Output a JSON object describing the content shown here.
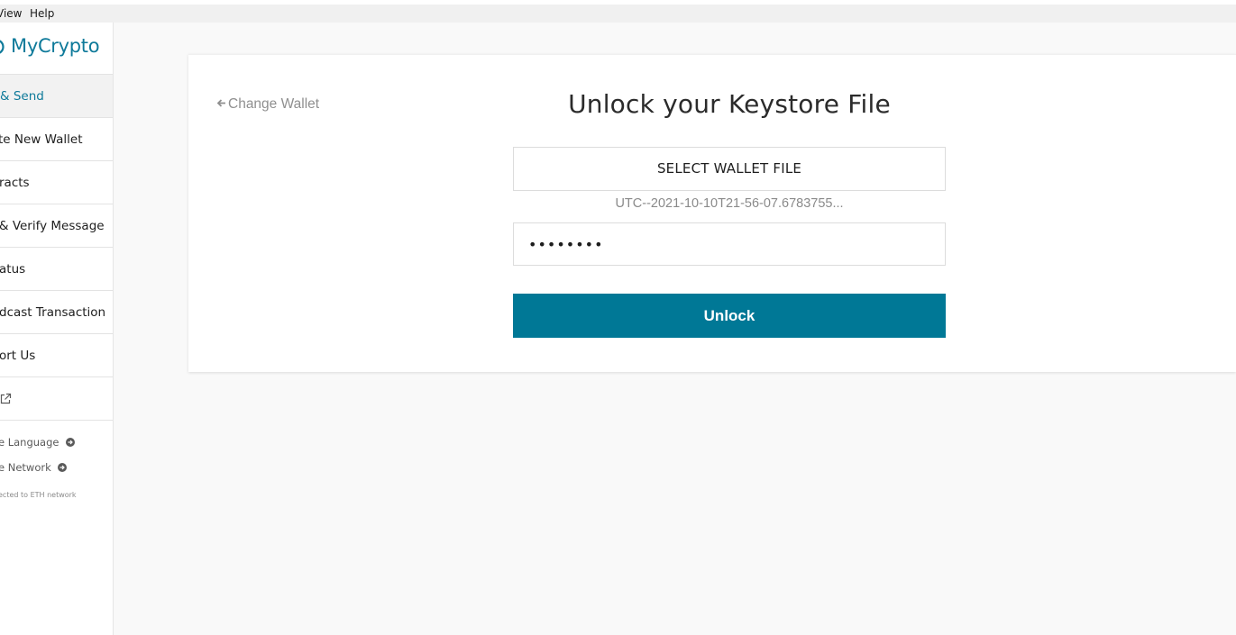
{
  "menubar": {
    "items": [
      "View",
      "Help"
    ]
  },
  "sidebar": {
    "logo_text": "MyCrypto",
    "items": [
      {
        "label": "& Send",
        "active": true
      },
      {
        "label": "te New Wallet"
      },
      {
        "label": "racts"
      },
      {
        "label": "& Verify Message"
      },
      {
        "label": "atus"
      },
      {
        "label": "dcast Transaction"
      },
      {
        "label": "ort Us"
      },
      {
        "label": "",
        "icon": "external-link-icon"
      }
    ],
    "language_link": "e Language",
    "network_link": "e Network",
    "network_status": "ected to ETH network"
  },
  "panel": {
    "back_link": "Change Wallet",
    "title": "Unlock your Keystore File",
    "select_file_label": "SELECT WALLET FILE",
    "file_name": "UTC--2021-10-10T21-56-07.6783755...",
    "password_value": "••••••••",
    "unlock_label": "Unlock"
  },
  "colors": {
    "brand": "#0e7a9a",
    "unlock_button": "#007896",
    "page_background": "#f9f9f9"
  }
}
